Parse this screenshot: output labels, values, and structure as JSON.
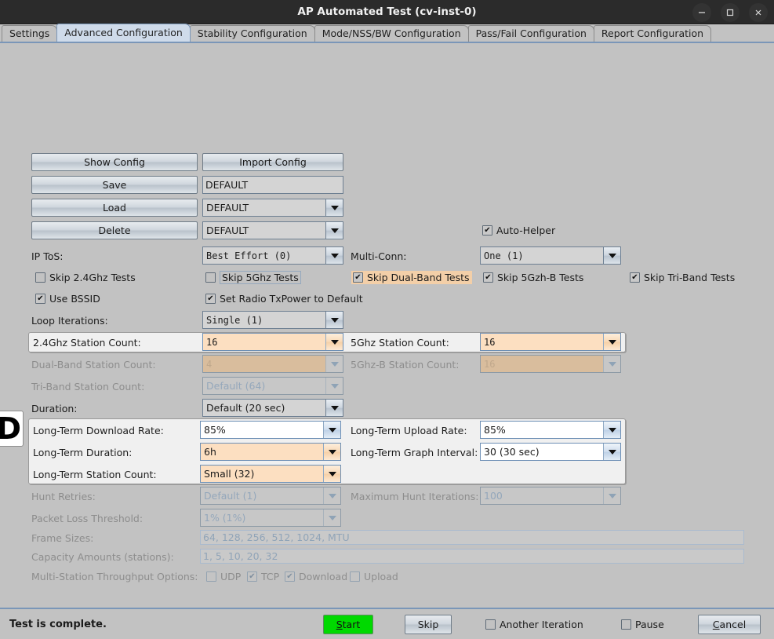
{
  "window": {
    "title": "AP Automated Test  (cv-inst-0)",
    "minimize": "minimize-icon",
    "maximize": "maximize-icon",
    "close": "close-icon"
  },
  "tabs": [
    {
      "label": "Settings",
      "active": false
    },
    {
      "label": "Advanced Configuration",
      "active": true
    },
    {
      "label": "Stability Configuration",
      "active": false
    },
    {
      "label": "Mode/NSS/BW Configuration",
      "active": false
    },
    {
      "label": "Pass/Fail Configuration",
      "active": false
    },
    {
      "label": "Report Configuration",
      "active": false
    }
  ],
  "config_actions": {
    "show_config": "Show Config",
    "import_config": "Import Config",
    "save": "Save",
    "load": "Load",
    "delete": "Delete",
    "save_value": "DEFAULT",
    "load_value": "DEFAULT",
    "delete_value": "DEFAULT"
  },
  "auto_helper": {
    "label": "Auto-Helper",
    "checked": true
  },
  "ip_tos": {
    "label": "IP ToS:",
    "value": "Best Effort    (0)"
  },
  "multi_conn": {
    "label": "Multi-Conn:",
    "value": "One (1)"
  },
  "skip_checks": {
    "skip_24": {
      "label": "Skip 2.4Ghz Tests",
      "checked": false
    },
    "skip_5": {
      "label": "Skip 5Ghz Tests",
      "checked": false
    },
    "skip_dual": {
      "label": "Skip Dual-Band Tests",
      "checked": true
    },
    "skip_5b": {
      "label": "Skip 5Gzh-B Tests",
      "checked": true
    },
    "skip_tri": {
      "label": "Skip Tri-Band Tests",
      "checked": true
    }
  },
  "radio_opts": {
    "use_bssid": {
      "label": "Use BSSID",
      "checked": true
    },
    "txpower": {
      "label": "Set Radio TxPower to Default",
      "checked": true
    }
  },
  "loop_iterations": {
    "label": "Loop Iterations:",
    "value": "Single       (1)"
  },
  "station_counts": {
    "sta_24": {
      "label": "2.4Ghz Station Count:",
      "value": "16"
    },
    "sta_5": {
      "label": "5Ghz Station Count:",
      "value": "16"
    },
    "sta_dual": {
      "label": "Dual-Band Station Count:",
      "value": "4"
    },
    "sta_5b": {
      "label": "5Ghz-B Station Count:",
      "value": "16"
    },
    "sta_tri": {
      "label": "Tri-Band Station Count:",
      "value": "Default (64)"
    }
  },
  "duration": {
    "label": "Duration:",
    "value": "Default (20 sec)"
  },
  "long_term": {
    "badge": "D",
    "download_rate": {
      "label": "Long-Term Download Rate:",
      "value": "85%"
    },
    "upload_rate": {
      "label": "Long-Term Upload Rate:",
      "value": "85%"
    },
    "lt_duration": {
      "label": "Long-Term Duration:",
      "value": "6h"
    },
    "graph_interval": {
      "label": "Long-Term Graph Interval:",
      "value": "30 (30 sec)"
    },
    "station_count": {
      "label": "Long-Term Station Count:",
      "value": "Small (32)"
    }
  },
  "hunt": {
    "retries": {
      "label": "Hunt Retries:",
      "value": "Default (1)"
    },
    "max_iterations": {
      "label": "Maximum Hunt Iterations:",
      "value": "100"
    }
  },
  "packet_loss": {
    "label": "Packet Loss Threshold:",
    "value": "1% (1%)"
  },
  "frame_sizes": {
    "label": "Frame Sizes:",
    "value": "64, 128, 256, 512, 1024, MTU"
  },
  "capacity_amounts": {
    "label": "Capacity Amounts (stations):",
    "value": "1, 5, 10, 20, 32"
  },
  "mst_options": {
    "label": "Multi-Station Throughput Options:",
    "udp": {
      "label": "UDP",
      "checked": false
    },
    "tcp": {
      "label": "TCP",
      "checked": true
    },
    "download": {
      "label": "Download",
      "checked": true
    },
    "upload": {
      "label": "Upload",
      "checked": false
    }
  },
  "statusbar": {
    "status": "Test is complete.",
    "start": "Start",
    "skip": "Skip",
    "another_iteration": {
      "label": "Another Iteration",
      "checked": false
    },
    "pause": {
      "label": "Pause",
      "checked": false
    },
    "cancel": "Cancel"
  },
  "colors": {
    "background": "#c2c2c2",
    "titlebar": "#2b2b2b",
    "accent": "#7a96b8",
    "active_tab": "#cfdbea",
    "highlight_peach": "#fcdfc1",
    "start_green": "#00d900"
  }
}
